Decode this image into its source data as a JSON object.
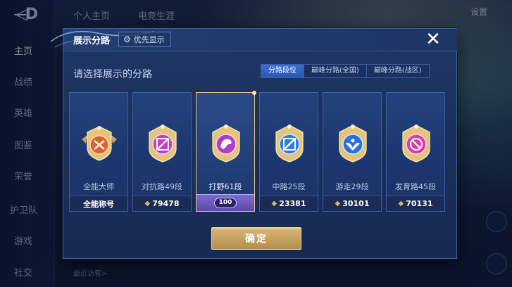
{
  "background": {
    "top_tabs": [
      "个人主页",
      "电竞生涯"
    ],
    "top_right_label": "设置",
    "nav": {
      "items": [
        "主页",
        "战绩",
        "英雄",
        "图鉴",
        "荣誉",
        "护卫队",
        "游戏",
        "社交"
      ]
    },
    "bottom_hint": "最近访客>"
  },
  "modal": {
    "title": "展示分路",
    "priority_label": "优先显示",
    "prompt": "请选择展示的分路",
    "tabs": [
      {
        "label": "分路段位",
        "active": true
      },
      {
        "label": "巅峰分路(全国)",
        "active": false
      },
      {
        "label": "巅峰分路(战区)",
        "active": false
      }
    ],
    "cards": [
      {
        "name": "全能大师",
        "bottom": "全能称号",
        "kind": "title",
        "color": "#d9632e"
      },
      {
        "name": "对抗路49段",
        "bottom": "79478",
        "kind": "score",
        "color": "#c23fc2"
      },
      {
        "name": "打野61段",
        "bottom": "100",
        "kind": "level",
        "color": "#b03ec0",
        "selected": true
      },
      {
        "name": "中路25段",
        "bottom": "23381",
        "kind": "score",
        "color": "#2a7fe0"
      },
      {
        "name": "游走29段",
        "bottom": "30101",
        "kind": "score",
        "color": "#2a72d8"
      },
      {
        "name": "发育路45段",
        "bottom": "70131",
        "kind": "score",
        "color": "#d23fa8"
      }
    ],
    "confirm_label": "确定"
  },
  "colors": {
    "accent_gold": "#d8b877",
    "tab_active": "#3a6fd0",
    "card_bg": "#1d3870"
  }
}
